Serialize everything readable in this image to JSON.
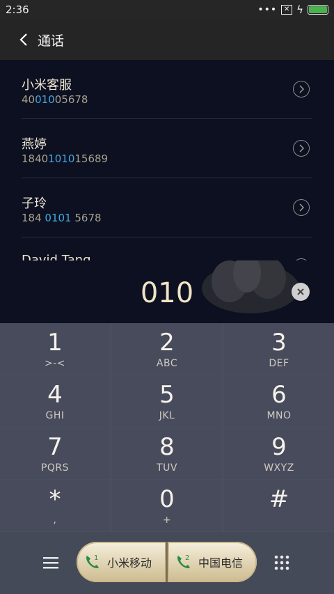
{
  "status_bar": {
    "time": "2:36"
  },
  "header": {
    "title": "通话"
  },
  "contacts": [
    {
      "name": "小米客服",
      "number_pre": "40",
      "number_match": "010",
      "number_post": "05678"
    },
    {
      "name": "燕婷",
      "number_pre": "1840",
      "number_match": "1010",
      "number_post": "15689"
    },
    {
      "name": "子玲",
      "number_pre": "184 ",
      "number_match": "0101",
      "number_post": " 5678"
    },
    {
      "name": "David Tang",
      "number_pre": "",
      "number_match": "",
      "number_post": ""
    }
  ],
  "dial_input": {
    "value": "010"
  },
  "keypad": [
    {
      "digit": "1",
      "letters": ">-<"
    },
    {
      "digit": "2",
      "letters": "ABC"
    },
    {
      "digit": "3",
      "letters": "DEF"
    },
    {
      "digit": "4",
      "letters": "GHI"
    },
    {
      "digit": "5",
      "letters": "JKL"
    },
    {
      "digit": "6",
      "letters": "MNO"
    },
    {
      "digit": "7",
      "letters": "PQRS"
    },
    {
      "digit": "8",
      "letters": "TUV"
    },
    {
      "digit": "9",
      "letters": "WXYZ"
    },
    {
      "digit": "*",
      "letters": ","
    },
    {
      "digit": "0",
      "letters": "+"
    },
    {
      "digit": "#",
      "letters": ""
    }
  ],
  "bottom": {
    "sim1": {
      "badge": "1",
      "label": "小米移动"
    },
    "sim2": {
      "badge": "2",
      "label": "中国电信"
    }
  },
  "colors": {
    "highlight": "#45a8df",
    "sim_button": "#e9dcc0",
    "keypad_bg": "#4a4f5f"
  },
  "icons": [
    "back-arrow-icon",
    "chevron-right-icon",
    "clear-icon",
    "menu-icon",
    "phone-icon",
    "dialpad-grid-icon",
    "battery-icon"
  ]
}
